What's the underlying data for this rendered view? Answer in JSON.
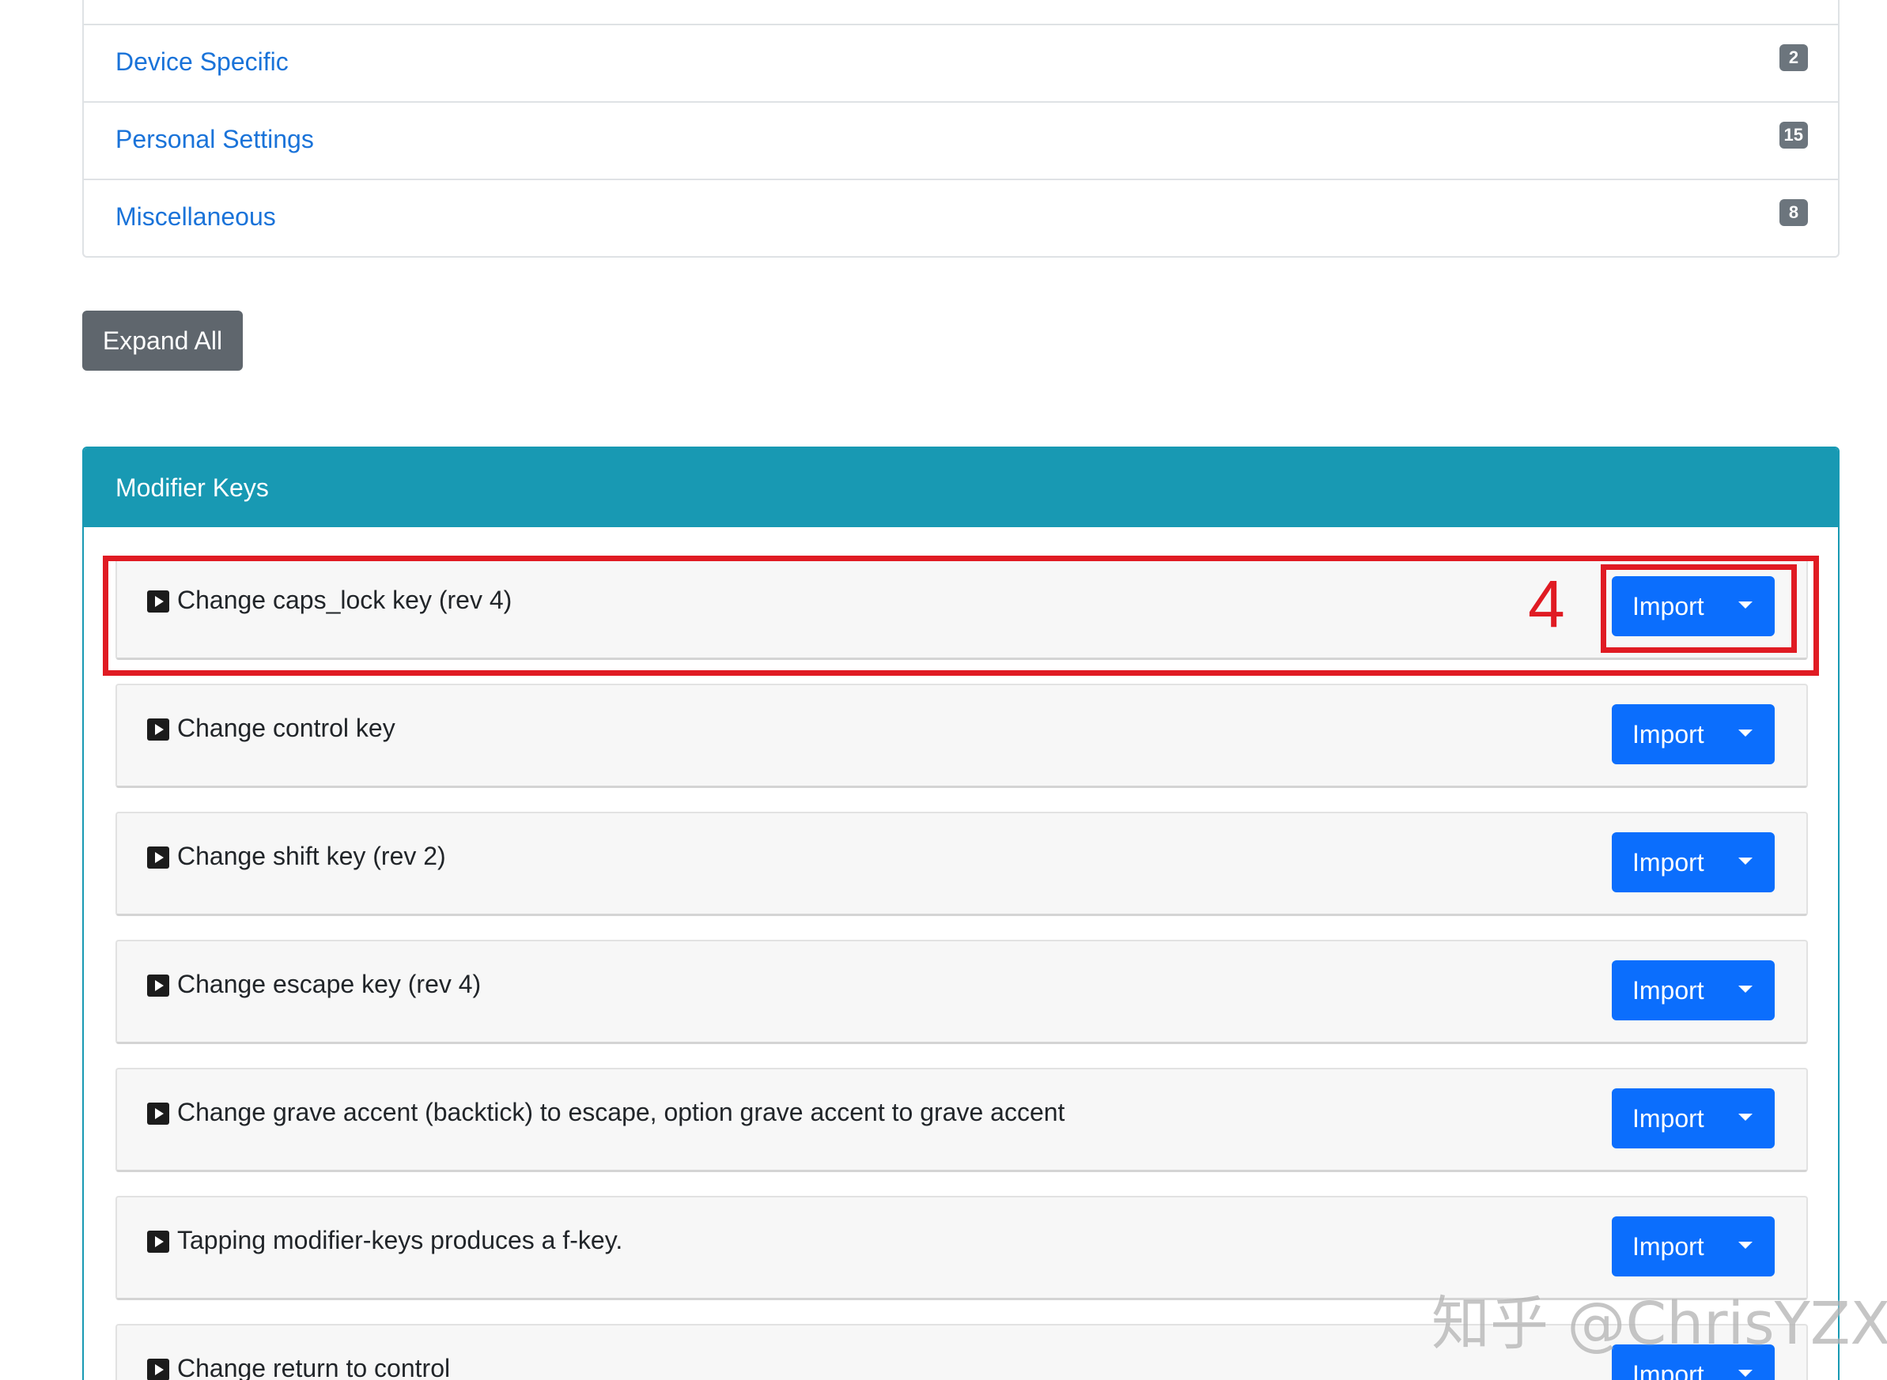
{
  "categories": [
    {
      "label": "Device Specific",
      "count": "2"
    },
    {
      "label": "Personal Settings",
      "count": "15"
    },
    {
      "label": "Miscellaneous",
      "count": "8"
    }
  ],
  "expand_all_label": "Expand All",
  "modifier_card": {
    "title": "Modifier Keys",
    "rules": [
      {
        "title": "Change caps_lock key (rev 4)",
        "button": "Import"
      },
      {
        "title": "Change control key",
        "button": "Import"
      },
      {
        "title": "Change shift key (rev 2)",
        "button": "Import"
      },
      {
        "title": "Change escape key (rev 4)",
        "button": "Import"
      },
      {
        "title": "Change grave accent (backtick) to escape, option grave accent to grave accent",
        "button": "Import"
      },
      {
        "title": "Tapping modifier-keys produces a f-key.",
        "button": "Import"
      },
      {
        "title": "Change return to control",
        "button": "Import"
      }
    ]
  },
  "annotation": {
    "step_number": "4",
    "color": "#e01b23"
  },
  "watermark": "知乎 @ChrisYZX",
  "colors": {
    "link": "#1a73d9",
    "header_teal": "#1899b3",
    "import_blue": "#0b6efd",
    "secondary_gray": "#6c757d"
  }
}
